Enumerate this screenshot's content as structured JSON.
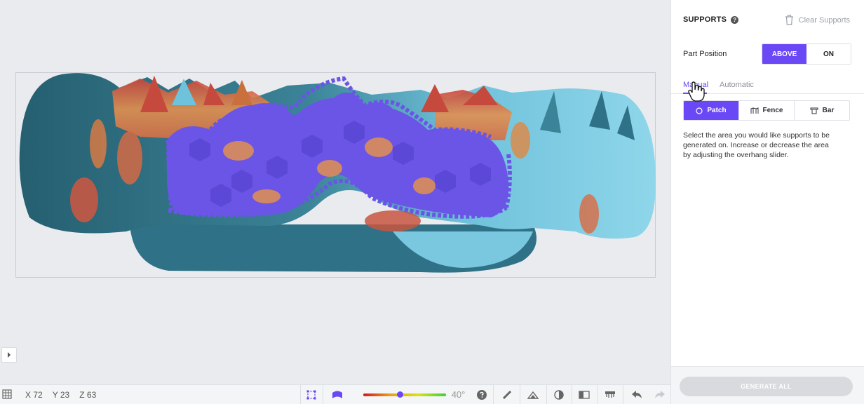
{
  "viewport": {
    "coords": {
      "x_label": "X",
      "x_value": "72",
      "y_label": "Y",
      "y_value": "23",
      "z_label": "Z",
      "z_value": "63"
    },
    "overhang_angle": "40°",
    "overhang_fraction": 0.45
  },
  "toolbar": {
    "icons": [
      "grid-icon",
      "select-box-icon",
      "support-mode-icon",
      "help-icon",
      "ruler-icon",
      "tilt-icon",
      "contrast-icon",
      "split-view-icon",
      "platform-icon",
      "undo-icon",
      "redo-icon"
    ]
  },
  "panel": {
    "title": "SUPPORTS",
    "clear_label": "Clear Supports",
    "part_position_label": "Part Position",
    "position_options": [
      "ABOVE",
      "ON"
    ],
    "tabs": [
      "Manual",
      "Automatic"
    ],
    "modes": [
      "Patch",
      "Fence",
      "Bar"
    ],
    "description": "Select the area you would like supports to be generated on. Increase or decrease the area by adjusting the overhang slider.",
    "generate_label": "GENERATE ALL"
  },
  "colors": {
    "accent": "#6a48f5",
    "teal": "#2b6f80",
    "light_blue": "#7fcde5"
  }
}
